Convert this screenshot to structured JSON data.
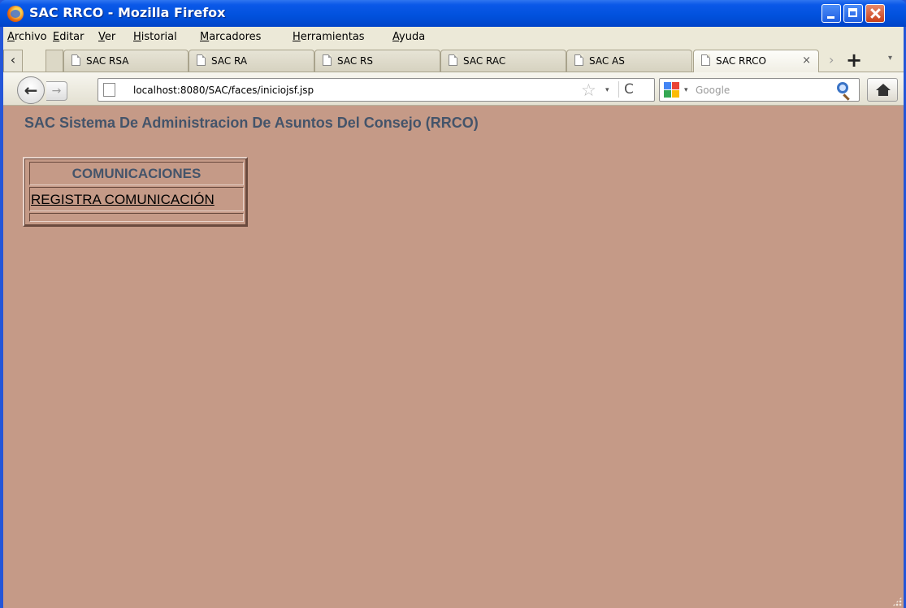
{
  "window": {
    "title": "SAC RRCO - Mozilla Firefox",
    "title_bar_color": "#0151dc"
  },
  "menu_bar": {
    "items": [
      {
        "accel": "A",
        "rest": "rchivo"
      },
      {
        "accel": "E",
        "rest": "ditar"
      },
      {
        "accel": "V",
        "rest": "er"
      },
      {
        "accel": "H",
        "rest": "istorial"
      },
      {
        "accel": "M",
        "rest": "arcadores"
      },
      {
        "accel": "H",
        "rest": "erramientas"
      },
      {
        "accel": "A",
        "rest": "yuda"
      }
    ]
  },
  "tabs": [
    {
      "label": "SAC RSA",
      "active": false
    },
    {
      "label": "SAC RA",
      "active": false
    },
    {
      "label": "SAC RS",
      "active": false
    },
    {
      "label": "SAC RAC",
      "active": false
    },
    {
      "label": "SAC AS",
      "active": false
    },
    {
      "label": "SAC RRCO",
      "active": true,
      "close_glyph": "×"
    }
  ],
  "tab_strip": {
    "scroll_left_glyph": "‹",
    "scroll_right_glyph": "›",
    "new_tab_glyph": "+",
    "list_all_glyph": "▾"
  },
  "navigation": {
    "back_glyph": "←",
    "forward_glyph": "→",
    "url": "localhost:8080/SAC/faces/iniciojsf.jsp",
    "bookmark_glyph": "☆",
    "dropdown_glyph": "▾",
    "reload_glyph": "C",
    "search_placeholder": "Google",
    "search_dropdown_glyph": "▾"
  },
  "page": {
    "background_color": "#c59a87",
    "text_color": "#44546a",
    "heading": "SAC Sistema De Administracion De Asuntos Del Consejo (RRCO)",
    "menu_table": {
      "header": "COMUNICACIONES",
      "link": "REGISTRA COMUNICACIÓN"
    }
  }
}
